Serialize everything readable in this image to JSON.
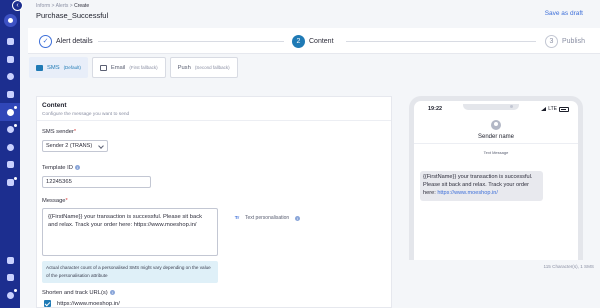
{
  "header": {
    "breadcrumb": [
      "Inform",
      "Alerts",
      "Create"
    ],
    "title": "Purchase_Successful",
    "save_draft": "Save as draft"
  },
  "stepper": {
    "steps": [
      {
        "number": "1",
        "label": "Alert details",
        "state": "completed"
      },
      {
        "number": "2",
        "label": "Content",
        "state": "active"
      },
      {
        "number": "3",
        "label": "Publish",
        "state": "pending"
      }
    ]
  },
  "channel_tabs": [
    {
      "label": "SMS",
      "note": "(Default)",
      "active": true
    },
    {
      "label": "Email",
      "note": "(First fallback)",
      "active": false
    },
    {
      "label": "Push",
      "note": "(Second fallback)",
      "active": false
    }
  ],
  "content": {
    "title": "Content",
    "subtitle": "Configure the message you want to send",
    "sms_sender_label": "SMS sender",
    "sms_sender_value": "Sender 2 (TRANS)",
    "template_id_label": "Template ID",
    "template_id_value": "12245365",
    "message_label": "Message",
    "message_value": "{{FirstName}} your transaction is successful. Please sit back and relax. Track your order here: https://www.moeshop.in/",
    "personalisation_label": "Text personalisation",
    "note": "Actual character count of a personalised SMS might vary depending on the value of the personalisation attribute",
    "track_label": "Shorten and track URL(s)",
    "track_url": "https://www.moeshop.in/"
  },
  "preview": {
    "time": "19:22",
    "network": "LTE",
    "sender_name": "Sender name",
    "message_type": "Text Message",
    "message_text": "{{FirstName}} your transaction is successful. Please sit back and relax. Track your order here: ",
    "message_link": "https://www.moeshop.in/",
    "char_count": "115 Character(s), 1 SMS"
  },
  "colors": {
    "sidebar": "#1c2e8f",
    "accent": "#1f7ab5",
    "link": "#3d6fd9"
  },
  "sidebar_icons": [
    "dashboard-icon",
    "analytics-icon",
    "segment-icon",
    "campaign-icon",
    "inform-icon",
    "user-icon",
    "personalize-icon",
    "content-icon",
    "flows-icon",
    "integrations-icon",
    "code-icon",
    "settings-icon"
  ]
}
